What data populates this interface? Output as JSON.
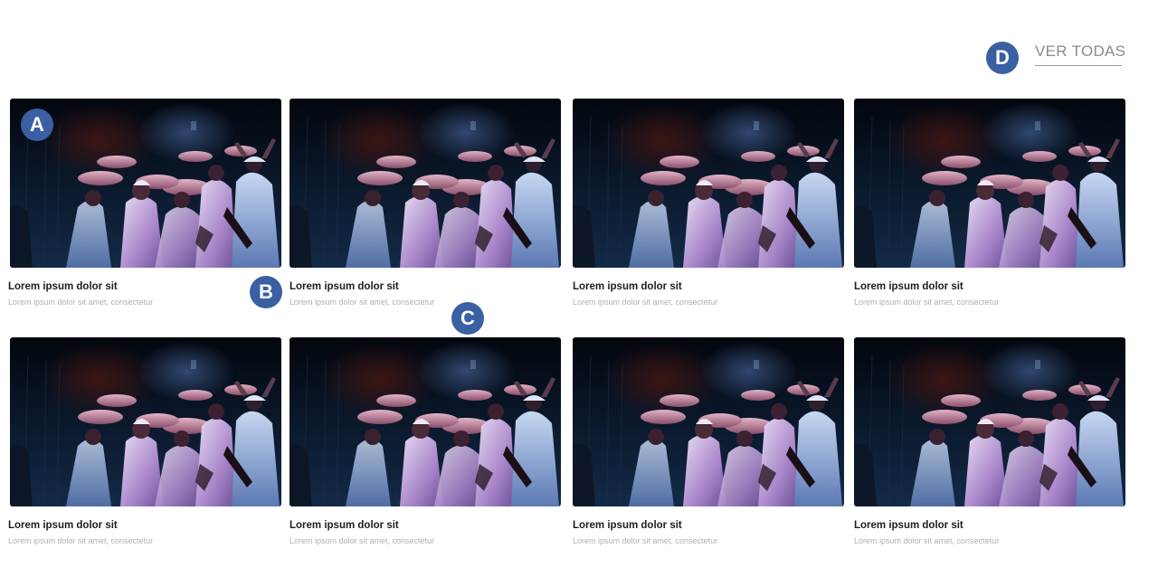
{
  "header": {
    "view_all_label": "VER TODAS"
  },
  "markers": {
    "a": "A",
    "b": "B",
    "c": "C",
    "d": "D"
  },
  "colors": {
    "marker": "#3a5fa3",
    "title": "#1e1e1e",
    "subtitle": "#b0b0b0",
    "link": "#8b8b8b"
  },
  "image_alt": "Photo of performers in white robes carrying baskets on their heads on a dark stage",
  "cards": [
    {
      "title": "Lorem ipsum dolor sit",
      "subtitle": "Lorem ipsum dolor sit amet, consectetur"
    },
    {
      "title": "Lorem ipsum dolor sit",
      "subtitle": "Lorem ipsum dolor sit amet, consectetur"
    },
    {
      "title": "Lorem ipsum dolor sit",
      "subtitle": "Lorem ipsum dolor sit amet, consectetur"
    },
    {
      "title": "Lorem ipsum dolor sit",
      "subtitle": "Lorem ipsum dolor sit amet, consectetur"
    },
    {
      "title": "Lorem ipsum dolor sit",
      "subtitle": "Lorem ipsum dolor sit amet, consectetur"
    },
    {
      "title": "Lorem ipsum dolor sit",
      "subtitle": "Lorem ipsum dolor sit amet, consectetur"
    },
    {
      "title": "Lorem ipsum dolor sit",
      "subtitle": "Lorem ipsum dolor sit amet, consectetur"
    },
    {
      "title": "Lorem ipsum dolor sit",
      "subtitle": "Lorem ipsum dolor sit amet, consectetur"
    }
  ]
}
